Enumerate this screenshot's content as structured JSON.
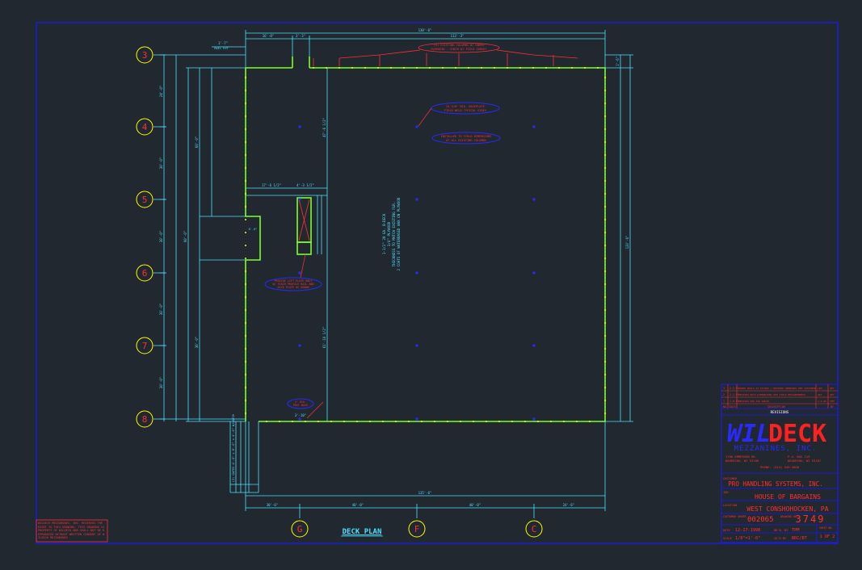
{
  "drawing": {
    "title": "DECK PLAN",
    "column_lines_vertical": [
      "3",
      "4",
      "5",
      "6",
      "7",
      "8"
    ],
    "column_lines_horizontal": [
      "G",
      "F",
      "C"
    ],
    "dims_top": [
      "1'-7\"",
      "16'-8\"",
      "3'-3\"",
      "130'-6\"",
      "113'-3\""
    ],
    "dims_bottom": [
      "30'-6\"",
      "40'-0\"",
      "40'-0\"",
      "24'-6\"",
      "135'-6\""
    ],
    "dims_left": [
      "24'-0\"",
      "30'-0\"",
      "30'-0\"",
      "30'-0\"",
      "30'-0\"",
      "90'-0\"",
      "60'-0\"",
      "36'-0\""
    ],
    "dims_right": [
      "1'-6\"",
      "120'-6\""
    ],
    "interior_dims": [
      "17'-6 1/2\"",
      "4'-3 1/2\"",
      "6'-0\"",
      "47'-6 1/2\"",
      "61'-10 1/2\""
    ],
    "note_center": [
      "1-1/2\" 20 GA. B-DECK",
      "3/4\" PLYWOOD",
      "THICKNESS TO MATCH EXISTING FLR.",
      "2 COATS OF WATERBASED WAX ON PLYWOOD"
    ],
    "note_top": [
      "(5) EXISTING COLUMNS W/ KNEES",
      "OVERHEAD - CHECK W/ FIELD SURVEY"
    ],
    "note_col_a": "24 5/8\" DIA. BASEPLATE",
    "note_col_b": "FIELD WELD TYPICAL SIDES",
    "note_field": "INSTALLED TO FIELD DIMENSIONS",
    "note_field_b": "AT ALL EXISTING COLUMNS",
    "note_stair": [
      "PROVIDE LIFT PLATE ONLY",
      "W/ STAIR PROFILE RAIL AND",
      "KICK PLATE AS SHOWN"
    ],
    "note_post": [
      "2\" DIA.",
      "POST BASE"
    ],
    "note_post_dim": "3'-10\"",
    "note_left_vertical": "(2) GATES 4'-0\" x 8'-0\" x 4'-6\" W/LATCH",
    "note_rail_ext": "RAIL EXT",
    "warning_text": "WILDECK MEZZANINES, INC. RESERVES THE RIGHT TO THIS DRAWING. THIS DRAWING IS PROPERTY OF WILDECK AND SHALL NOT BE REPRODUCED WITHOUT WRITTEN CONSENT OF WILDECK MEZZANINES"
  },
  "title_block": {
    "revisions": [
      {
        "no": "3",
        "date": "2-2-99",
        "desc": "ADDED RAILS AT STAIRS / REVISED OPENINGS PER CUSTOMER",
        "by": "LIM",
        "ck": "AKT"
      },
      {
        "no": "2",
        "date": "2-2-99",
        "desc": "REVISED DECK DIMENSIONS PER FIELD MEASUREMENTS",
        "by": "AKT",
        "ck": "AKT"
      },
      {
        "no": "1",
        "date": "1-6-99",
        "desc": "REVISED PER FAX ROUTE",
        "by": "1-6-99",
        "ck": "TPM"
      }
    ],
    "rev_header": [
      "NO.",
      "DATE",
      "DESCRIPTION",
      "BY"
    ],
    "revisions_label": "REVISIONS",
    "logo_wil": "WIL",
    "logo_deck": "DECK",
    "company": "MEZZANINES, INC.",
    "addr_left": [
      "1700 EMMERSON RD.",
      "WAUKESHA, WI 53186"
    ],
    "addr_right": [
      "P.O. BOX 219",
      "WAUKESHA, WI 53187"
    ],
    "phone": "PHONE: (414) 549-4000",
    "customer_label": "CUSTOMER",
    "customer": "PRO HANDLING SYSTEMS, INC.",
    "job_label": "JOB",
    "job": "HOUSE OF BARGAINS",
    "location_label": "LOCATION",
    "location": "WEST CONSHOHOCKEN, PA",
    "order_label": "CUSTOMER ORDER",
    "order_no": "002065",
    "drawing_label": "DRAWING NO.",
    "drawing_no": "3749",
    "date_label": "DATE",
    "date": "12-17-1998",
    "drawn_by_label": "DR'N. BY",
    "drawn_by": "TPM",
    "scale_label": "SCALE",
    "scale": "1/8\"=1'-0\"",
    "checked_label": "CK'D BY",
    "checked_by": "BRC/BT",
    "sheet_label": "SHEET NO.",
    "sheet": "1 OF 2"
  },
  "colors": {
    "background": "#212830",
    "border": "#1a1aff",
    "dimension": "#4fe0ff",
    "deck_edge": "#7dff2a",
    "annotation": "#ff3030",
    "grid_bubble": "#ffff00",
    "column": "#2a2aff"
  }
}
